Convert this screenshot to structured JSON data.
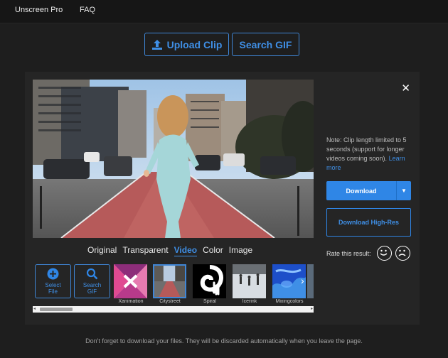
{
  "nav": {
    "brand": "Unscreen Pro",
    "faq": "FAQ"
  },
  "actions": {
    "upload": "Upload Clip",
    "search_gif": "Search GIF"
  },
  "result": {
    "note_text": "Note: Clip length limited to 5 seconds (support for longer videos coming soon).",
    "note_link": "Learn more",
    "download": "Download",
    "download_hires": "Download High-Res",
    "rate_label": "Rate this result:"
  },
  "tabs": [
    "Original",
    "Transparent",
    "Video",
    "Color",
    "Image"
  ],
  "active_tab": "Video",
  "strip": {
    "select_file": "Select File",
    "search_gif": "Search GIF",
    "backgrounds": [
      "Xanimation",
      "Citystreet",
      "Spiral",
      "Icerink",
      "Mixingcolors"
    ]
  },
  "footer": "Don't forget to download your files. They will be discarded automatically when you leave the page.",
  "colors": {
    "accent": "#2f86e6",
    "background": "#1e1e1e",
    "panel": "#252525"
  }
}
